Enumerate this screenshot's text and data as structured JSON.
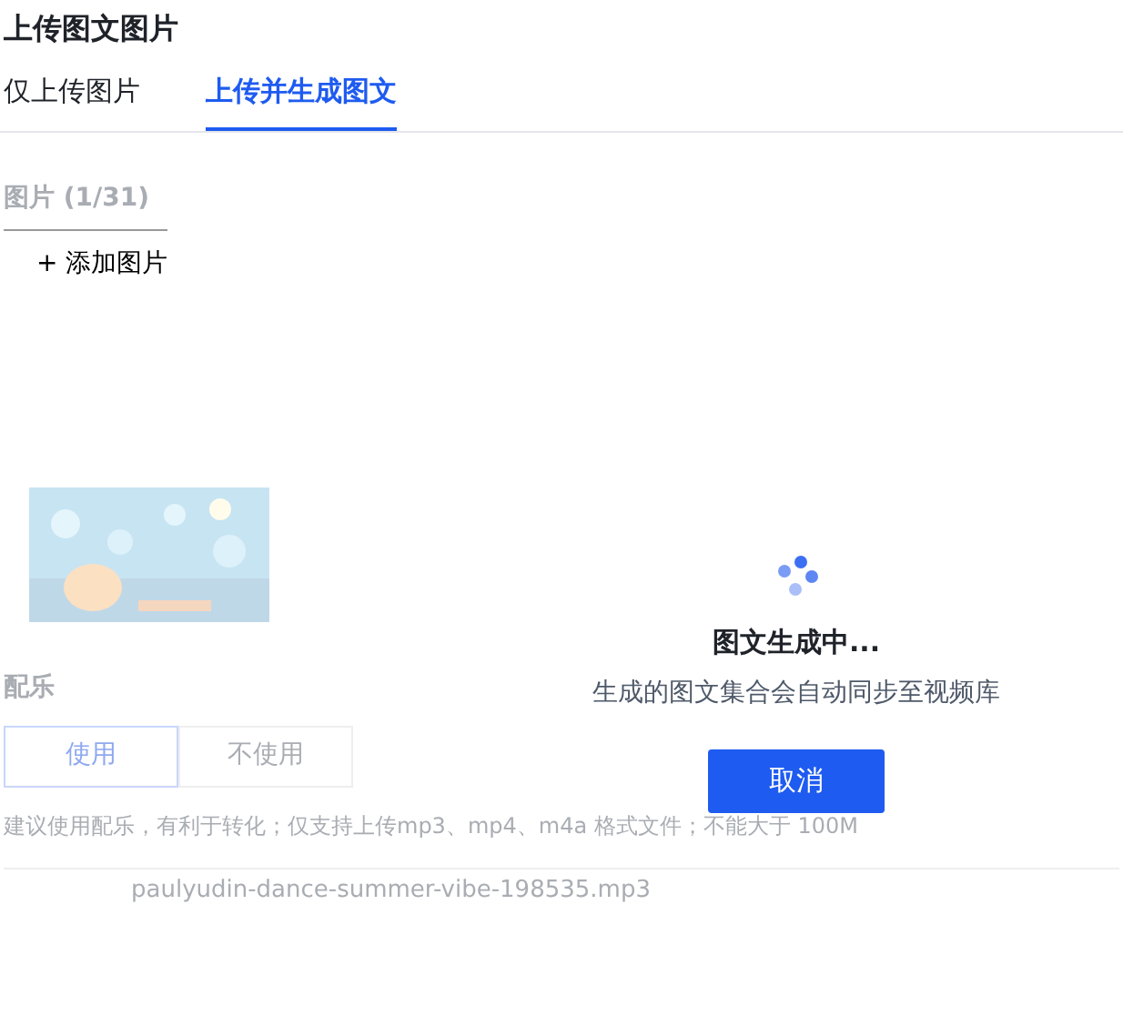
{
  "window": {
    "title": "上传图文图片"
  },
  "tabs": [
    {
      "label": "仅上传图片",
      "selected": false
    },
    {
      "label": "上传并生成图文",
      "selected": true
    }
  ],
  "images": {
    "label": "图片 (1/31)",
    "add_button": "+ 添加图片"
  },
  "music": {
    "label": "配乐",
    "options": [
      {
        "label": "使用",
        "selected": true
      },
      {
        "label": "不使用",
        "selected": false
      }
    ],
    "hint": "建议使用配乐，有利于转化；仅支持上传mp3、mp4、m4a 格式文件；不能大于 100M",
    "file": "paulyudin-dance-summer-vibe-198535.mp3"
  },
  "loading": {
    "title": "图文生成中...",
    "message": "生成的图文集合会自动同步至视频库",
    "cancel_button": "取消"
  }
}
